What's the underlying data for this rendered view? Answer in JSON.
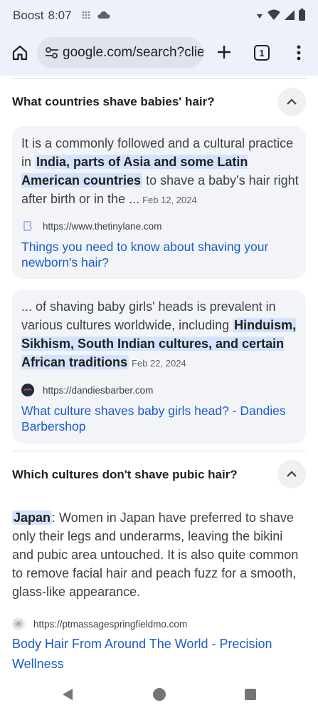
{
  "status_bar": {
    "carrier": "Boost",
    "time": "8:07"
  },
  "browser": {
    "url": "google.com/search?clier",
    "tab_count": "1"
  },
  "faq": [
    {
      "question": "What countries shave babies' hair?",
      "expanded": true,
      "results": [
        {
          "snippet_before": "It is a commonly followed and a cultural practice in ",
          "snippet_highlight": "India, parts of Asia and some Latin American countries",
          "snippet_after": " to shave a baby's hair right after birth or in the ...",
          "date": "Feb 12, 2024",
          "source_url": "https://www.thetinylane.com",
          "title": "Things you need to know about shaving your newborn's hair?"
        },
        {
          "snippet_before": "... of shaving baby girls' heads is prevalent in various cultures worldwide, including ",
          "snippet_highlight": "Hinduism, Sikhism, South Indian cultures, and certain African traditions",
          "snippet_after": "",
          "date": "Feb 22, 2024",
          "source_url": "https://dandiesbarber.com",
          "title": "What culture shaves baby girls head? - Dandies Barbershop"
        }
      ]
    },
    {
      "question": "Which cultures don't shave pubic hair?",
      "expanded": true,
      "answer_highlight": "Japan",
      "answer_text": ": Women in Japan have preferred to shave only their legs and underarms, leaving the bikini and pubic area untouched. It is also quite common to remove facial hair and peach fuzz for a smooth, glass-like appearance.",
      "source_url": "https://ptmassagespringfieldmo.com",
      "title": "Body Hair From Around The World - Precision Wellness"
    }
  ],
  "colors": {
    "link": "#1a5dc9",
    "highlight": "#d3e3fd",
    "toolbar_bg": "#edf1fa",
    "card_bg": "#f2f4f8"
  }
}
